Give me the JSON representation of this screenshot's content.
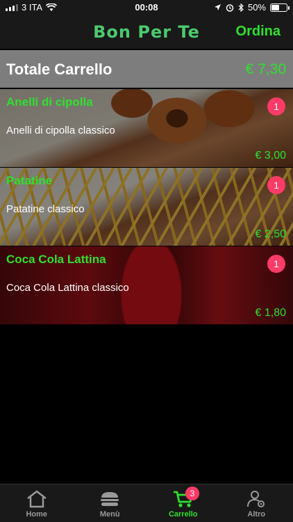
{
  "status_bar": {
    "carrier": "3 ITA",
    "time": "00:08",
    "battery": "50%",
    "battery_level": 0.5
  },
  "header": {
    "title": "Bon Per Te",
    "order_label": "Ordina"
  },
  "cart": {
    "total_label": "Totale Carrello",
    "total_value": "€ 7,30",
    "items": [
      {
        "name": "Anelli di cipolla",
        "description": "Anelli di cipolla classico",
        "quantity": "1",
        "price": "€ 3,00",
        "photo": "onion-rings-photo"
      },
      {
        "name": "Patatine",
        "description": "Patatine classico",
        "quantity": "1",
        "price": "€ 2,50",
        "photo": "french-fries-photo"
      },
      {
        "name": "Coca Cola Lattina",
        "description": "Coca Cola Lattina classico",
        "quantity": "1",
        "price": "€ 1,80",
        "photo": "coca-cola-can-photo"
      }
    ]
  },
  "tabs": [
    {
      "label": "Home",
      "icon": "home-icon"
    },
    {
      "label": "Menù",
      "icon": "burger-icon"
    },
    {
      "label": "Carrello",
      "icon": "cart-icon",
      "badge": "3",
      "active": true
    },
    {
      "label": "Altro",
      "icon": "user-settings-icon"
    }
  ],
  "colors": {
    "accent": "#2fe02f",
    "title": "#4cc96f",
    "badge": "#ff3b67",
    "bar_background": "#191919",
    "total_background": "#7d7d7d"
  }
}
